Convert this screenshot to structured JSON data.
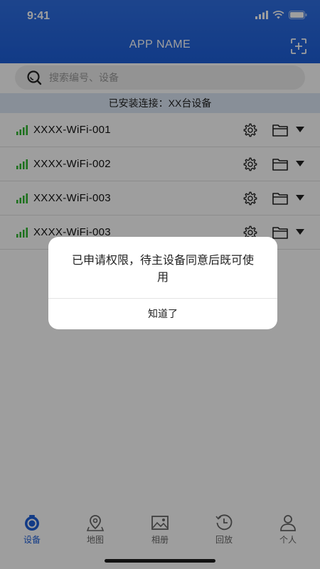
{
  "status_bar": {
    "time": "9:41"
  },
  "header": {
    "title": "APP NAME"
  },
  "search": {
    "placeholder": "搜索编号、设备"
  },
  "banner": {
    "text": "已安装连接：XX台设备"
  },
  "devices": [
    {
      "name": "XXXX-WiFi-001"
    },
    {
      "name": "XXXX-WiFi-002"
    },
    {
      "name": "XXXX-WiFi-003"
    },
    {
      "name": "XXXX-WiFi-003"
    }
  ],
  "dialog": {
    "message": "已申请权限，待主设备同意后既可使用",
    "confirm_label": "知道了"
  },
  "tabs": [
    {
      "label": "设备",
      "icon": "device-icon",
      "active": true
    },
    {
      "label": "地图",
      "icon": "map-pin-icon",
      "active": false
    },
    {
      "label": "相册",
      "icon": "image-icon",
      "active": false
    },
    {
      "label": "回放",
      "icon": "history-icon",
      "active": false
    },
    {
      "label": "个人",
      "icon": "person-icon",
      "active": false
    }
  ],
  "colors": {
    "primary": "#1d5fd9",
    "banner_bg": "#dbe7f6",
    "signal_green": "#2db52d",
    "overlay": "rgba(0,0,0,0.38)"
  }
}
